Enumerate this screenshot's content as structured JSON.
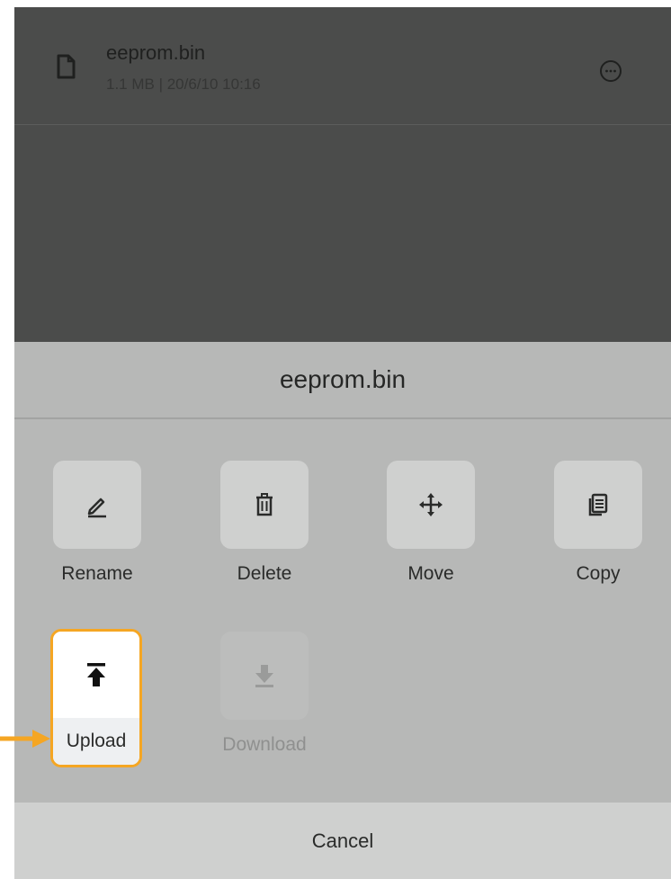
{
  "file": {
    "name": "eeprom.bin",
    "meta": "1.1 MB | 20/6/10 10:16"
  },
  "sheet": {
    "title": "eeprom.bin",
    "actions": [
      {
        "label": "Rename",
        "icon": "pencil-icon",
        "enabled": true
      },
      {
        "label": "Delete",
        "icon": "trash-icon",
        "enabled": true
      },
      {
        "label": "Move",
        "icon": "move-icon",
        "enabled": true
      },
      {
        "label": "Copy",
        "icon": "copy-icon",
        "enabled": true
      },
      {
        "label": "Upload",
        "icon": "upload-icon",
        "enabled": true,
        "highlighted": true
      },
      {
        "label": "Download",
        "icon": "download-icon",
        "enabled": false
      }
    ],
    "cancel_label": "Cancel"
  },
  "colors": {
    "highlight": "#f5a623",
    "overlay": "#4b4c4b",
    "sheet": "#b7b8b7"
  }
}
